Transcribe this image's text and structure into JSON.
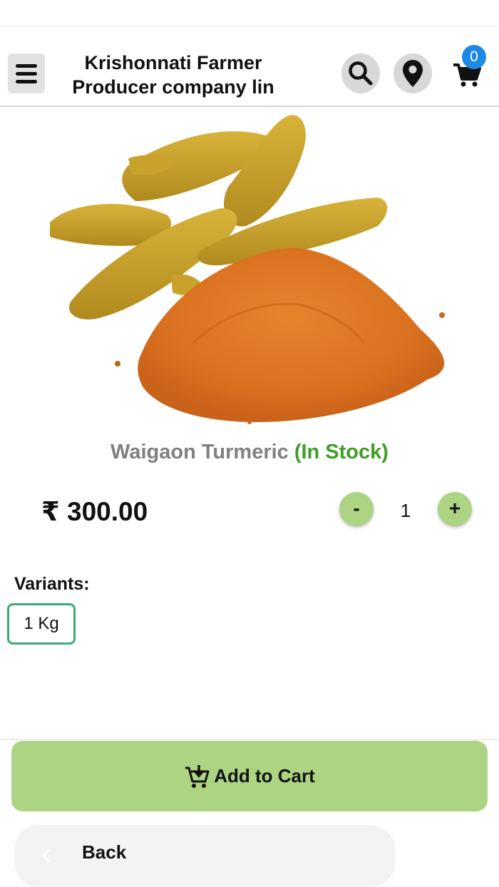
{
  "header": {
    "title_line1": "Krishonnati Farmer",
    "title_line2": "Producer company lin",
    "cart_count": "0",
    "icons": [
      "menu-icon",
      "search-icon",
      "location-pin-icon",
      "cart-icon"
    ]
  },
  "product": {
    "name": "Waigaon Turmeric",
    "stock": "(In Stock)",
    "price": "₹ 300.00",
    "quantity": "1",
    "minus_label": "-",
    "plus_label": "+"
  },
  "variants": {
    "label": "Variants:",
    "items": [
      "1 Kg"
    ],
    "selected": "1 Kg"
  },
  "actions": {
    "add_to_cart": "Add to Cart",
    "back": "Back"
  },
  "colors": {
    "accent_green": "#acd482",
    "stock_green": "#3e9d24",
    "variant_border": "#3aab72",
    "badge_blue": "#1e88e5"
  }
}
